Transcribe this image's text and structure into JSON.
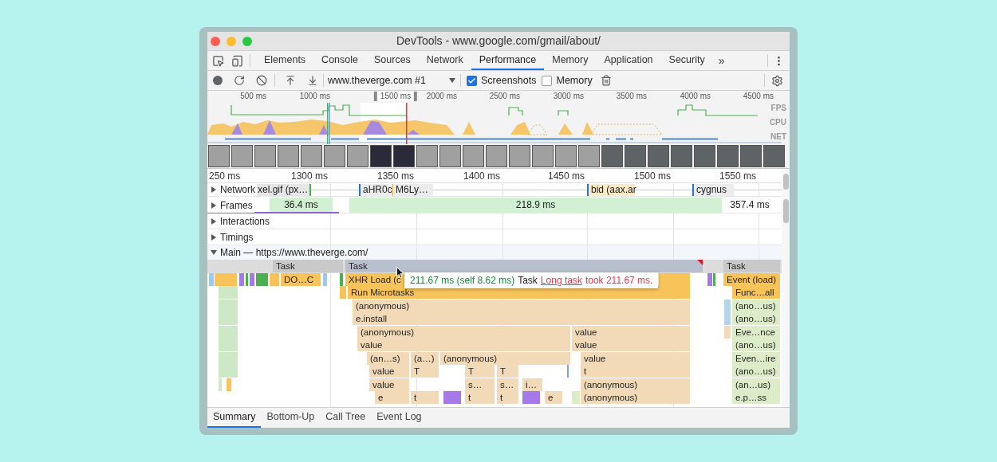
{
  "window": {
    "title": "DevTools - www.google.com/gmail/about/"
  },
  "tabs": [
    {
      "label": "Elements",
      "selected": false
    },
    {
      "label": "Console",
      "selected": false
    },
    {
      "label": "Sources",
      "selected": false
    },
    {
      "label": "Network",
      "selected": false
    },
    {
      "label": "Performance",
      "selected": true
    },
    {
      "label": "Memory",
      "selected": false
    },
    {
      "label": "Application",
      "selected": false
    },
    {
      "label": "Security",
      "selected": false
    }
  ],
  "tabs_overflow": "»",
  "toolbar": {
    "profile_select": {
      "value": "www.theverge.com #1"
    },
    "checkboxes": [
      {
        "label": "Screenshots",
        "checked": true
      },
      {
        "label": "Memory",
        "checked": false
      }
    ]
  },
  "overview": {
    "ruler": [
      {
        "label": "500 ms",
        "selected": false
      },
      {
        "label": "1000 ms",
        "selected": false
      },
      {
        "label": "1500 ms",
        "selected": true
      },
      {
        "label": "2000 ms",
        "selected": false
      },
      {
        "label": "2500 ms",
        "selected": false
      },
      {
        "label": "3000 ms",
        "selected": false
      },
      {
        "label": "3500 ms",
        "selected": false
      },
      {
        "label": "4000 ms",
        "selected": false
      },
      {
        "label": "4500 ms",
        "selected": false
      }
    ],
    "lanes": [
      "FPS",
      "CPU",
      "NET"
    ]
  },
  "timeline_ruler": [
    "250 ms",
    "1300 ms",
    "1350 ms",
    "1400 ms",
    "1450 ms",
    "1500 ms",
    "1550 ms"
  ],
  "tracks": [
    {
      "kind": "network",
      "label": "Network",
      "expanded": false,
      "items": [
        "xel.gif (px…",
        "aHR0c",
        "M6Ly…",
        "bid (aax.ar",
        "cygnus"
      ]
    },
    {
      "kind": "frames",
      "label": "Frames",
      "expanded": false,
      "items": [
        "36.4 ms",
        "218.9 ms",
        "357.4 ms"
      ]
    },
    {
      "kind": "plain",
      "label": "Interactions",
      "expanded": false
    },
    {
      "kind": "plain",
      "label": "Timings",
      "expanded": false
    },
    {
      "kind": "main",
      "label": "Main — https://www.theverge.com/",
      "expanded": true
    }
  ],
  "flame_rows": [
    {
      "blocks": [
        {
          "label": "Task",
          "kind": "task",
          "selected": false,
          "long_task": false
        },
        {
          "label": "Task",
          "kind": "task",
          "selected": true,
          "long_task": true
        },
        {
          "label": "Task",
          "kind": "task",
          "selected": false,
          "long_task": false
        }
      ]
    },
    {
      "blocks": [
        {
          "label": "DO…C",
          "kind": "event"
        },
        {
          "label": "XHR Load (c",
          "kind": "event"
        },
        {
          "label": "Event (load)",
          "kind": "event"
        }
      ]
    },
    {
      "blocks": [
        {
          "label": "Run Microtasks",
          "kind": "event"
        },
        {
          "label": "Func…all",
          "kind": "event"
        }
      ]
    },
    {
      "blocks": [
        {
          "label": "(anonymous)",
          "kind": "call"
        },
        {
          "label": "(ano…us)",
          "kind": "green"
        }
      ]
    },
    {
      "blocks": [
        {
          "label": "e.install",
          "kind": "call"
        },
        {
          "label": "(ano…us)",
          "kind": "green"
        }
      ]
    },
    {
      "blocks": [
        {
          "label": "(anonymous)",
          "kind": "call"
        },
        {
          "label": "value",
          "kind": "call"
        },
        {
          "label": "Eve…nce",
          "kind": "green"
        }
      ]
    },
    {
      "blocks": [
        {
          "label": "value",
          "kind": "call"
        },
        {
          "label": "value",
          "kind": "call"
        },
        {
          "label": "(ano…us)",
          "kind": "green"
        }
      ]
    },
    {
      "blocks": [
        {
          "label": "(an…s)",
          "kind": "call"
        },
        {
          "label": "(a…)",
          "kind": "call"
        },
        {
          "label": "(anonymous)",
          "kind": "call"
        },
        {
          "label": "value",
          "kind": "call"
        },
        {
          "label": "Even…ire",
          "kind": "green"
        }
      ]
    },
    {
      "blocks": [
        {
          "label": "value",
          "kind": "call"
        },
        {
          "label": "T",
          "kind": "call"
        },
        {
          "label": "T",
          "kind": "call"
        },
        {
          "label": "T",
          "kind": "call"
        },
        {
          "label": "t",
          "kind": "call"
        },
        {
          "label": "(ano…us)",
          "kind": "green"
        }
      ]
    },
    {
      "blocks": [
        {
          "label": "value",
          "kind": "call"
        },
        {
          "label": "s…",
          "kind": "call"
        },
        {
          "label": "s…",
          "kind": "call"
        },
        {
          "label": "i…",
          "kind": "call"
        },
        {
          "label": "(anonymous)",
          "kind": "call"
        },
        {
          "label": "(an…us)",
          "kind": "green"
        }
      ]
    },
    {
      "blocks": [
        {
          "label": "e",
          "kind": "call"
        },
        {
          "label": "t",
          "kind": "call"
        },
        {
          "label": "t",
          "kind": "call"
        },
        {
          "label": "t",
          "kind": "call"
        },
        {
          "label": "e",
          "kind": "call"
        },
        {
          "label": "(anonymous)",
          "kind": "call"
        },
        {
          "label": "e.p…ss",
          "kind": "green"
        }
      ]
    }
  ],
  "tooltip": {
    "duration": "211.67 ms (self 8.62 ms)",
    "name": "Task",
    "link": "Long task",
    "message": "took 211.67 ms."
  },
  "bottom_tabs": [
    {
      "label": "Summary",
      "selected": true
    },
    {
      "label": "Bottom-Up",
      "selected": false
    },
    {
      "label": "Call Tree",
      "selected": false
    },
    {
      "label": "Event Log",
      "selected": false
    }
  ]
}
